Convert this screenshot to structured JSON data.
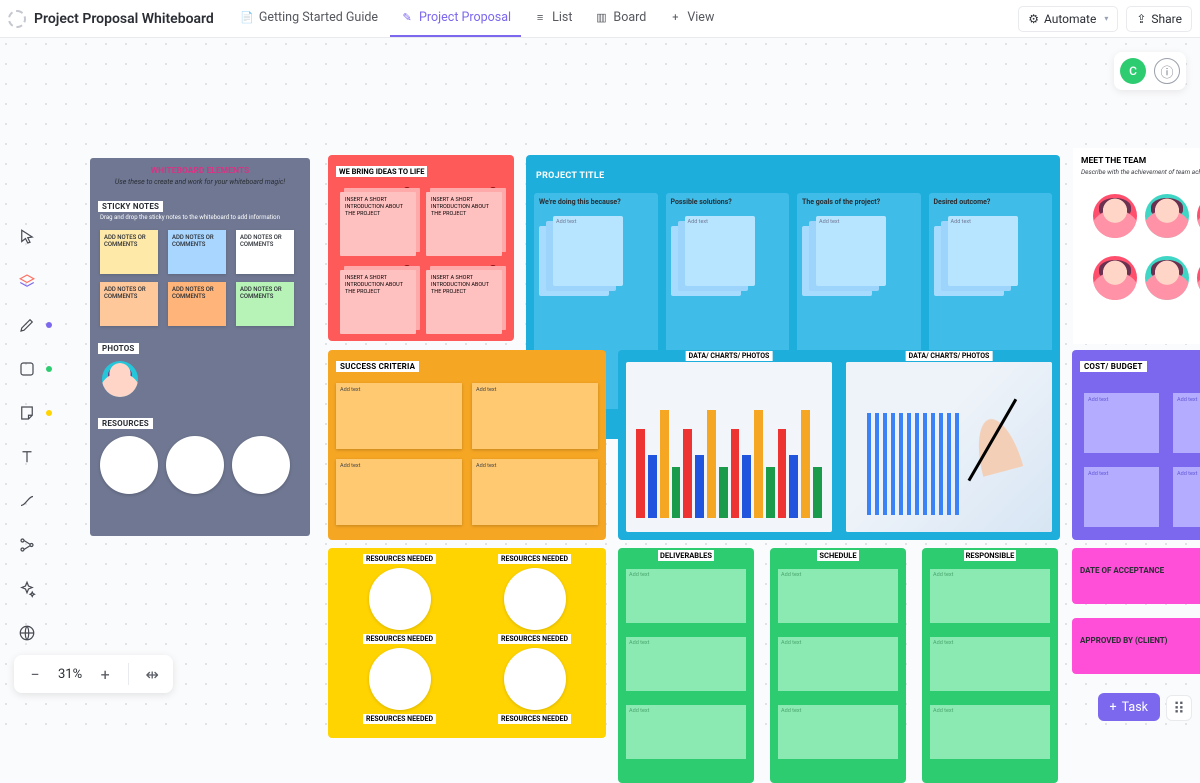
{
  "header": {
    "title": "Project Proposal Whiteboard",
    "tabs": [
      {
        "label": "Getting Started Guide"
      },
      {
        "label": "Project Proposal"
      },
      {
        "label": "List"
      },
      {
        "label": "Board"
      },
      {
        "label": "View"
      }
    ],
    "automate": "Automate",
    "share": "Share"
  },
  "user": {
    "initial": "C"
  },
  "zoom": {
    "value": "31%"
  },
  "task": {
    "label": "Task"
  },
  "elements": {
    "title": "WHITEBOARD ELEMENTS",
    "subtitle": "Use these to create and work for your whiteboard magic!",
    "sticky_header": "STICKY NOTES",
    "sticky_hint": "Drag and drop the sticky notes to the whiteboard to add information",
    "note_text": "ADD NOTES OR COMMENTS",
    "photos_header": "PHOTOS",
    "resources_header": "RESOURCES"
  },
  "ideas": {
    "header": "WE BRING IDEAS TO LIFE",
    "note_text": "INSERT A SHORT INTRODUCTION ABOUT THE PROJECT"
  },
  "project": {
    "title": "PROJECT TITLE",
    "cols": [
      "We're doing this because?",
      "Possible solutions?",
      "The goals of the project?",
      "Desired outcome?"
    ],
    "hint": "Add text"
  },
  "team": {
    "header": "MEET THE TEAM",
    "subtitle": "Describe with the achievement of team achievements"
  },
  "success": {
    "header": "SUCCESS CRITERIA",
    "hint": "Add text"
  },
  "charts": {
    "header": "DATA/ CHARTS/ PHOTOS"
  },
  "cost": {
    "header": "COST/ BUDGET",
    "hint": "Add text"
  },
  "resources": {
    "header": "RESOURCES NEEDED"
  },
  "green": {
    "deliverables": "DELIVERABLES",
    "schedule": "SCHEDULE",
    "responsible": "RESPONSIBLE",
    "hint": "Add text"
  },
  "pink": {
    "acceptance": "DATE OF ACCEPTANCE",
    "approved": "APPROVED BY (CLIENT)"
  }
}
